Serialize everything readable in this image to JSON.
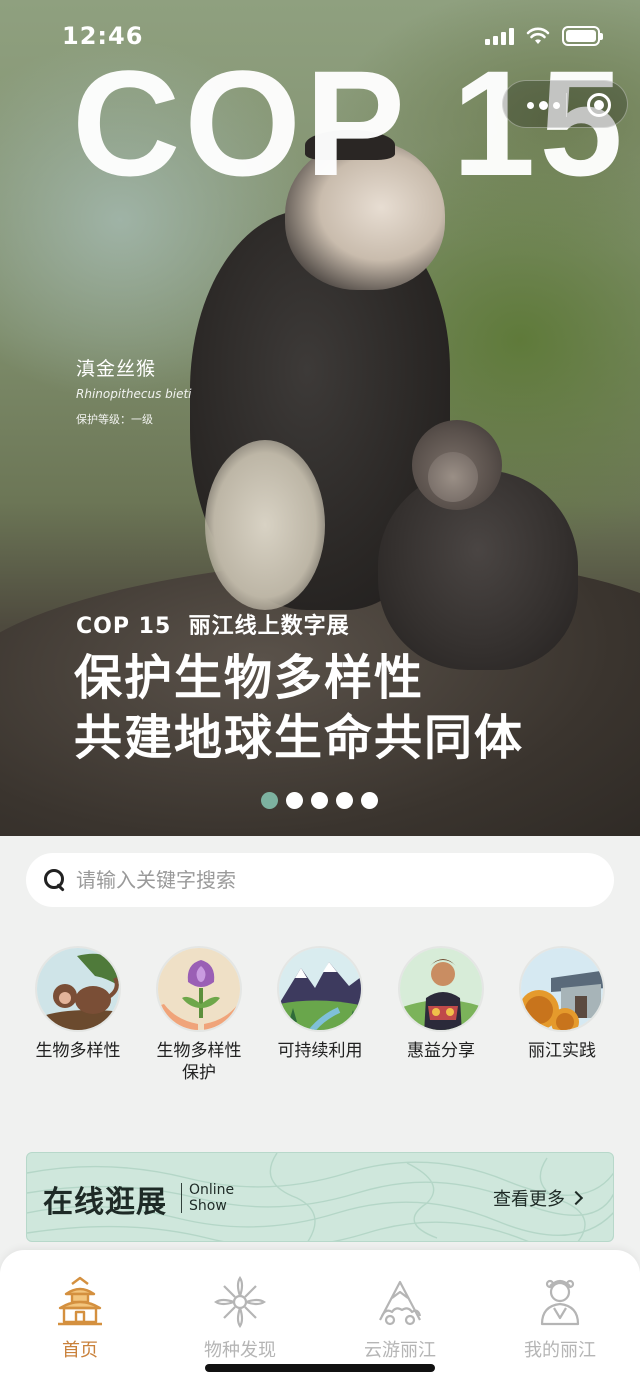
{
  "status": {
    "time": "12:46"
  },
  "hero": {
    "title": "COP 15",
    "species_name": "滇金丝猴",
    "species_latin": "Rhinopithecus bieti",
    "protection_level": "保护等级：一级",
    "exhibit_subtitle": "COP 15  丽江线上数字展",
    "headline_line1": "保护生物多样性",
    "headline_line2": "共建地球生命共同体",
    "carousel_count": 5,
    "carousel_active": 1,
    "active_dot_color": "#7db2a0"
  },
  "search": {
    "placeholder": "请输入关键字搜索"
  },
  "categories": [
    {
      "label": "生物多样性",
      "icon": "monkey-icon"
    },
    {
      "label": "生物多样性",
      "label2": "保护",
      "icon": "flower-hands-icon"
    },
    {
      "label": "可持续利用",
      "icon": "mountains-icon"
    },
    {
      "label": "惠益分享",
      "icon": "person-icon"
    },
    {
      "label": "丽江实践",
      "icon": "pavilion-icon"
    }
  ],
  "online_show": {
    "title": "在线逛展",
    "english_line1": "Online",
    "english_line2": "Show",
    "more_label": "查看更多"
  },
  "tabs": [
    {
      "label": "首页",
      "icon": "pagoda-icon",
      "active": true
    },
    {
      "label": "物种发现",
      "icon": "species-icon",
      "active": false
    },
    {
      "label": "云游丽江",
      "icon": "cloud-mountain-icon",
      "active": false
    },
    {
      "label": "我的丽江",
      "icon": "profile-icon",
      "active": false
    }
  ],
  "colors": {
    "accent": "#c9813b",
    "banner": "#cfe7dc",
    "tab_inactive": "#b5b5b5"
  }
}
